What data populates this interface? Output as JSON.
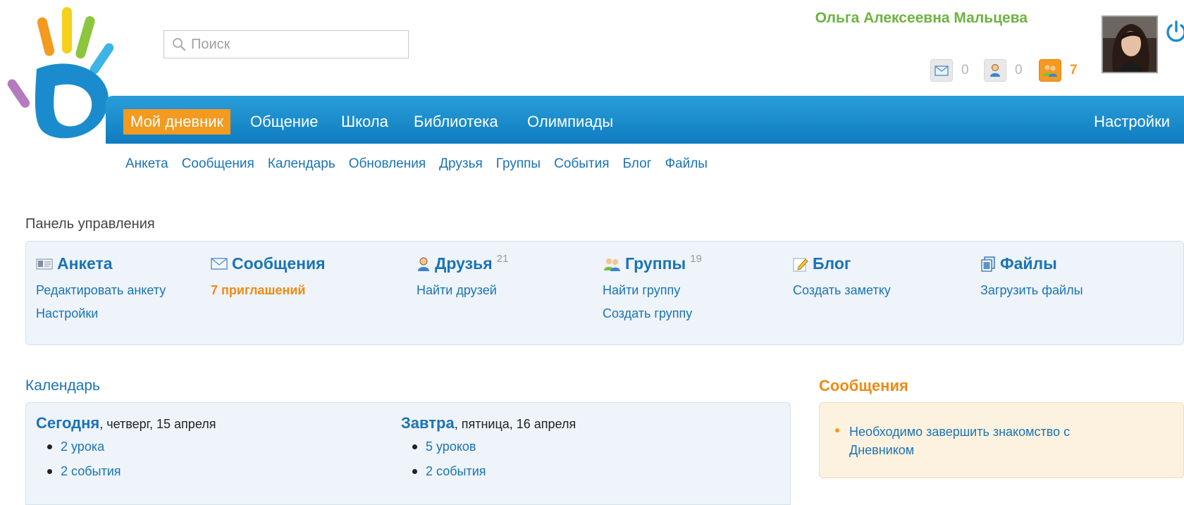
{
  "search": {
    "placeholder": "Поиск"
  },
  "user": {
    "name": "Ольга Алексеевна Мальцева",
    "counters": [
      {
        "icon": "envelope-icon",
        "value": "0",
        "active": false
      },
      {
        "icon": "person-icon",
        "value": "0",
        "active": false
      },
      {
        "icon": "people-icon",
        "value": "7",
        "active": true
      }
    ]
  },
  "nav": {
    "items": [
      "Мой дневник",
      "Общение",
      "Школа",
      "Библиотека",
      "Олимпиады"
    ],
    "settings": "Настройки"
  },
  "subnav": [
    "Анкета",
    "Сообщения",
    "Календарь",
    "Обновления",
    "Друзья",
    "Группы",
    "События",
    "Блог",
    "Файлы"
  ],
  "panel": {
    "title": "Панель управления",
    "columns": [
      {
        "title": "Анкета",
        "icon": "profile-card-icon",
        "links": [
          "Редактировать анкету",
          "Настройки"
        ]
      },
      {
        "title": "Сообщения",
        "icon": "envelope-icon",
        "links": [
          "7 приглашений"
        ]
      },
      {
        "title": "Друзья",
        "count": "21",
        "icon": "person-icon",
        "links": [
          "Найти друзей"
        ]
      },
      {
        "title": "Группы",
        "count": "19",
        "icon": "people-icon",
        "links": [
          "Найти группу",
          "Создать группу"
        ]
      },
      {
        "title": "Блог",
        "icon": "pencil-note-icon",
        "links": [
          "Создать заметку"
        ]
      },
      {
        "title": "Файлы",
        "icon": "files-icon",
        "links": [
          "Загрузить файлы"
        ]
      }
    ]
  },
  "calendar": {
    "title": "Календарь",
    "today": {
      "label": "Сегодня",
      "date": ", четверг, 15 апреля",
      "items": [
        "2 урока",
        "2 события"
      ]
    },
    "tomorrow": {
      "label": "Завтра",
      "date": ", пятница, 16 апреля",
      "items": [
        "5 уроков",
        "2 события"
      ]
    }
  },
  "messages": {
    "title": "Сообщения",
    "items": [
      "Необходимо завершить знакомство с Дневником"
    ]
  },
  "colors": {
    "accent": "#f39a1f",
    "nav_blue": "#1a8ccd",
    "link": "#1a73b5",
    "user_green": "#6db33f"
  }
}
